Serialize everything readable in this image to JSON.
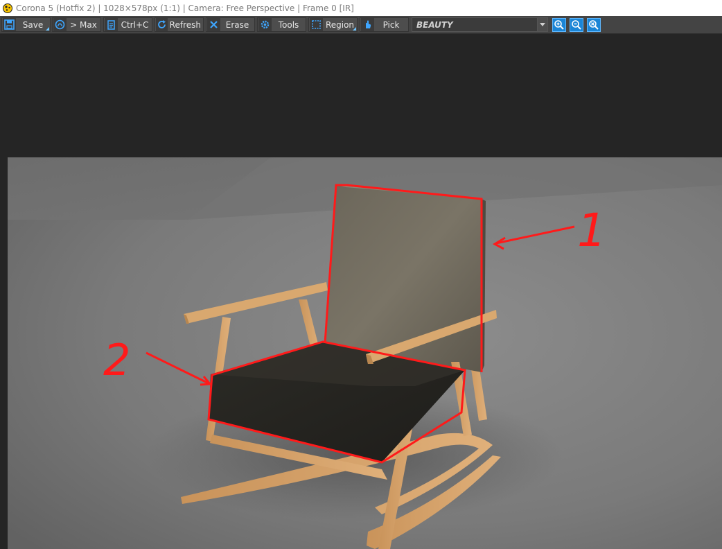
{
  "window": {
    "title": "Corona 5 (Hotfix 2) | 1028×578px (1:1) | Camera: Free Perspective | Frame 0 [IR]",
    "app_icon": "corona-logo-icon"
  },
  "toolbar": {
    "save_label": "Save",
    "max_label": "> Max",
    "copy_label": "Ctrl+C",
    "refresh_label": "Refresh",
    "erase_label": "Erase",
    "tools_label": "Tools",
    "region_label": "Region",
    "pick_label": "Pick",
    "render_element": "BEAUTY",
    "icons": {
      "save": "floppy-disk-icon",
      "max": "max-logo-icon",
      "copy": "clipboard-icon",
      "refresh": "refresh-icon",
      "erase": "erase-x-icon",
      "tools": "gear-icon",
      "region": "region-select-icon",
      "pick": "hand-pointer-icon",
      "zoom_in": "zoom-in-icon",
      "zoom_out": "zoom-out-icon",
      "zoom_fit": "zoom-fit-icon"
    }
  },
  "accent_colors": {
    "icon_blue": "#1b85d6",
    "annotation_red": "#ff1a1a"
  },
  "annotations": {
    "label_1": "1",
    "label_2": "2"
  }
}
